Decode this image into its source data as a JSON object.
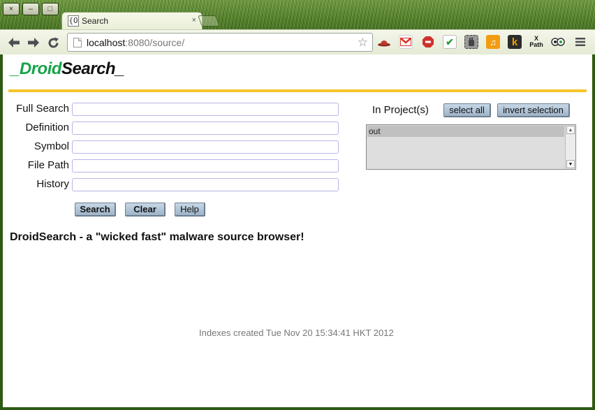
{
  "window": {
    "close_label": "×",
    "minimize_label": "–",
    "maximize_label": "□"
  },
  "tab": {
    "favicon_text": "{O",
    "title": "Search",
    "close_label": "×"
  },
  "toolbar": {
    "url_host": "localhost",
    "url_rest": ":8080/source/",
    "extensions": [
      {
        "name": "hat-icon",
        "text": "",
        "color": "#c0392b"
      },
      {
        "name": "gmail-icon",
        "text": "M",
        "color": "#d93025"
      },
      {
        "name": "stop-icon",
        "text": "",
        "color": "#d0312d"
      },
      {
        "name": "check-icon",
        "text": "✔",
        "color": "#2a9d3a"
      },
      {
        "name": "hand-icon",
        "text": "",
        "color": "#666"
      },
      {
        "name": "music-icon",
        "text": "♫",
        "color": "#f39c12"
      },
      {
        "name": "k-icon",
        "text": "k",
        "color": "#e08a00"
      },
      {
        "name": "xpath-icon",
        "text": "X Path",
        "color": "#111"
      },
      {
        "name": "owl-icon",
        "text": "",
        "color": "#555"
      }
    ]
  },
  "page": {
    "logo_prefix": "_",
    "logo_green": "Droid",
    "logo_black": "Search_",
    "form": {
      "fields": [
        {
          "label": "Full Search",
          "value": ""
        },
        {
          "label": "Definition",
          "value": ""
        },
        {
          "label": "Symbol",
          "value": ""
        },
        {
          "label": "File Path",
          "value": ""
        },
        {
          "label": "History",
          "value": ""
        }
      ],
      "search_label": "Search",
      "clear_label": "Clear",
      "help_label": "Help"
    },
    "projects": {
      "label": "In Project(s)",
      "select_all_label": "select all",
      "invert_label": "invert selection",
      "items": [
        "out"
      ]
    },
    "tagline": "DroidSearch - a \"wicked fast\" malware source browser!",
    "footer": "Indexes created Tue Nov 20 15:34:41 HKT 2012"
  }
}
